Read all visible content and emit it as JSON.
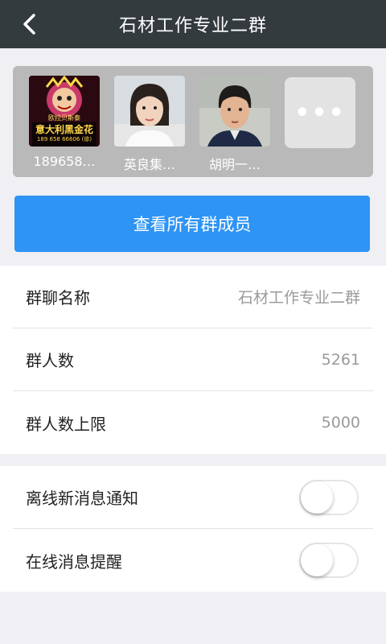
{
  "header": {
    "title": "石材工作专业二群"
  },
  "members": [
    {
      "name": "189658…",
      "avatar_text_line1": "意大利黑金花",
      "avatar_text_line2": "189 658 66606 (徐)",
      "avatar_top_text": "欧拉贝斯泰"
    },
    {
      "name": "英良集…"
    },
    {
      "name": "胡明一…"
    }
  ],
  "more": {
    "label": "•••"
  },
  "view_all_button": {
    "label": "查看所有群成员"
  },
  "info": {
    "group_name_label": "群聊名称",
    "group_name_value": "石材工作专业二群",
    "member_count_label": "群人数",
    "member_count_value": "5261",
    "member_limit_label": "群人数上限",
    "member_limit_value": "5000"
  },
  "settings": {
    "offline_notify_label": "离线新消息通知",
    "offline_notify_on": false,
    "online_alert_label": "在线消息提醒",
    "online_alert_on": false
  },
  "colors": {
    "header_bg": "#343b3f",
    "accent": "#2e94f5",
    "page_bg": "#efeff4"
  }
}
